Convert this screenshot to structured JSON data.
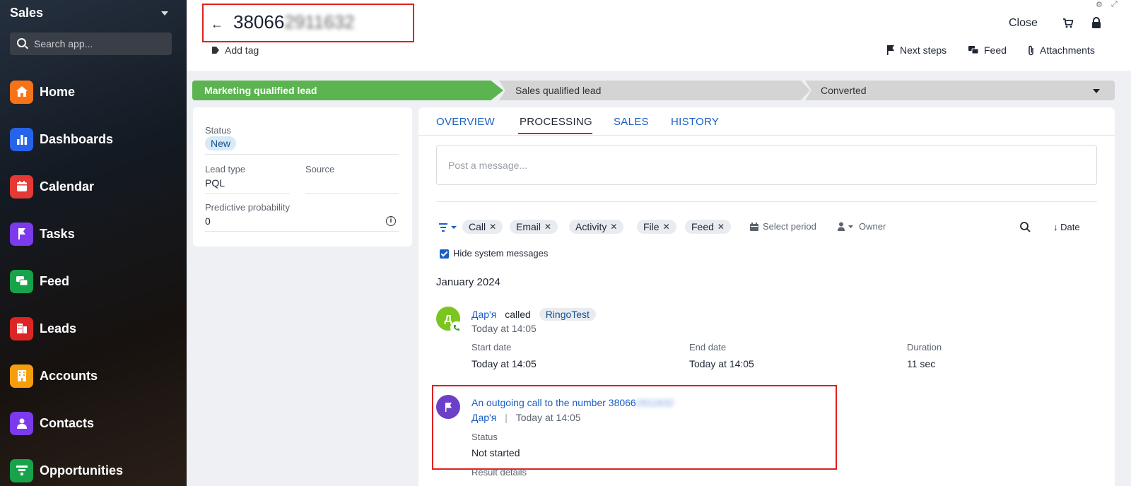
{
  "sidebar": {
    "title": "Sales",
    "search_placeholder": "Search app...",
    "items": [
      {
        "label": "Home",
        "icon": "home-icon",
        "color": "#f97316"
      },
      {
        "label": "Dashboards",
        "icon": "bar-chart-icon",
        "color": "#2563eb"
      },
      {
        "label": "Calendar",
        "icon": "calendar-icon",
        "color": "#e53935"
      },
      {
        "label": "Tasks",
        "icon": "flag-icon",
        "color": "#7c3aed"
      },
      {
        "label": "Feed",
        "icon": "chat-icon",
        "color": "#16a34a"
      },
      {
        "label": "Leads",
        "icon": "leads-icon",
        "color": "#dc2626"
      },
      {
        "label": "Accounts",
        "icon": "building-icon",
        "color": "#f59e0b"
      },
      {
        "label": "Contacts",
        "icon": "person-icon",
        "color": "#7c3aed"
      },
      {
        "label": "Opportunities",
        "icon": "funnel-icon",
        "color": "#16a34a"
      }
    ]
  },
  "header": {
    "title_visible": "38066",
    "title_blurred": "2911632",
    "add_tag": "Add tag",
    "close": "Close",
    "actions": {
      "next_steps": "Next steps",
      "feed": "Feed",
      "attachments": "Attachments"
    }
  },
  "stages": [
    "Marketing qualified lead",
    "Sales qualified lead",
    "Converted"
  ],
  "info": {
    "status_label": "Status",
    "status_value": "New",
    "lead_type_label": "Lead type",
    "lead_type_value": "PQL",
    "source_label": "Source",
    "source_value": "",
    "probability_label": "Predictive probability",
    "probability_value": "0"
  },
  "tabs": [
    "OVERVIEW",
    "PROCESSING",
    "SALES",
    "HISTORY"
  ],
  "active_tab": "PROCESSING",
  "post_placeholder": "Post a message...",
  "filters": {
    "chips": [
      "Call",
      "Email",
      "Activity",
      "File",
      "Feed"
    ],
    "select_period": "Select period",
    "owner": "Owner",
    "date": "Date",
    "hide_system": "Hide system messages"
  },
  "timeline": {
    "month": "January 2024",
    "call": {
      "avatar_letter": "Д",
      "user": "Дар'я",
      "verb": "called",
      "target": "RingoTest",
      "time": "Today at 14:05",
      "start_label": "Start date",
      "start_value": "Today at 14:05",
      "end_label": "End date",
      "end_value": "Today at 14:05",
      "duration_label": "Duration",
      "duration_value": "11 sec"
    },
    "task": {
      "title_visible": "An outgoing call to the number 38066",
      "title_blurred": "2911632",
      "user": "Дар'я",
      "separator": "|",
      "time": "Today at 14:05",
      "status_label": "Status",
      "status_value": "Not started",
      "result_label": "Result details"
    }
  }
}
